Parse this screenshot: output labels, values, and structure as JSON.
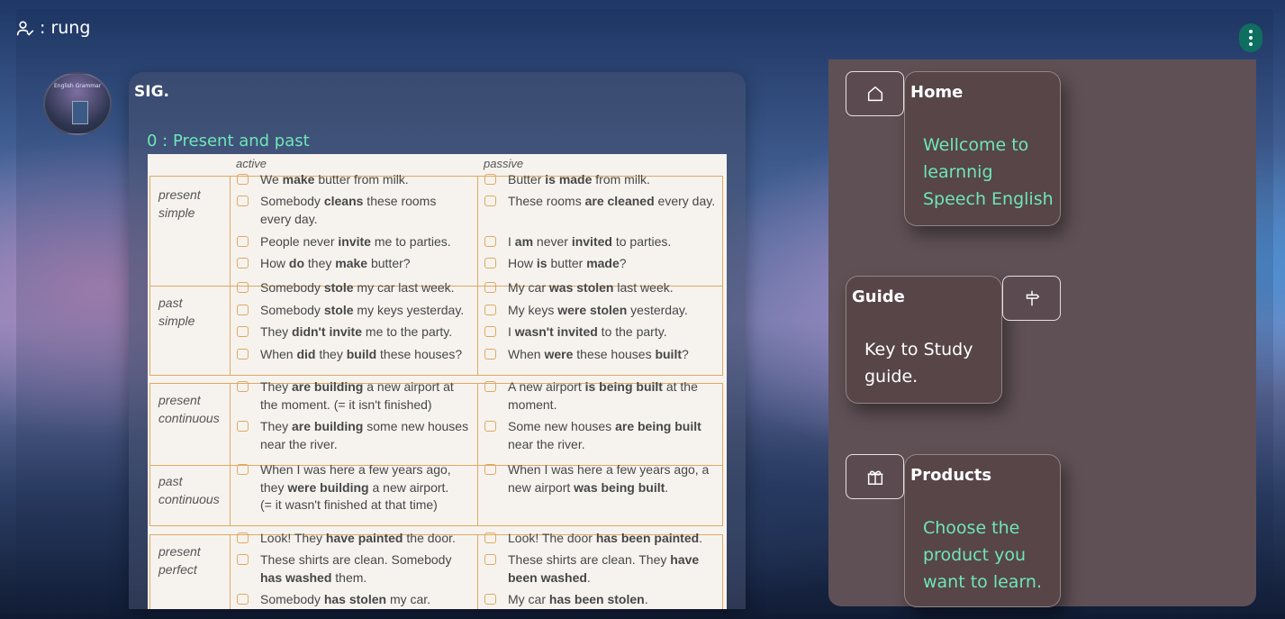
{
  "user": {
    "icon": "user-check-icon",
    "label": ": rung"
  },
  "post": {
    "author": "SIG.",
    "title": "0 : Present and past",
    "grammar_page": {
      "col_active": "active",
      "col_passive": "passive",
      "rows": [
        {
          "tense": [
            "present",
            "simple"
          ]
        },
        {
          "tense": [
            "past",
            "simple"
          ]
        },
        {
          "tense": [
            "present",
            "continuous"
          ]
        },
        {
          "tense": [
            "past",
            "continuous"
          ]
        },
        {
          "tense": [
            "present",
            "perfect"
          ]
        }
      ],
      "active_items": [
        [
          "We ",
          {
            "b": "make"
          },
          " butter from milk."
        ],
        [
          "Somebody ",
          {
            "b": "cleans"
          },
          " these rooms"
        ],
        [
          "every day."
        ],
        [
          "People never ",
          {
            "b": "invite"
          },
          " me to parties."
        ],
        [
          "How ",
          {
            "b": "do"
          },
          " they ",
          {
            "b": "make"
          },
          " butter?"
        ],
        [
          "Somebody ",
          {
            "b": "stole"
          },
          " my car last week."
        ],
        [
          "Somebody ",
          {
            "b": "stole"
          },
          " my keys yesterday."
        ],
        [
          "They ",
          {
            "b": "didn't invite"
          },
          " me to the party."
        ],
        [
          "When ",
          {
            "b": "did"
          },
          " they ",
          {
            "b": "build"
          },
          " these houses?"
        ],
        [
          "They ",
          {
            "b": "are building"
          },
          " a new airport at"
        ],
        [
          "the moment.   (= it isn't finished)"
        ],
        [
          "They ",
          {
            "b": "are building"
          },
          " some new houses"
        ],
        [
          "near the river."
        ],
        [
          "When I was here a few years ago,"
        ],
        [
          "they ",
          {
            "b": "were building"
          },
          " a new airport."
        ],
        [
          "(= it wasn't finished at that time)"
        ],
        [
          "Look!  They ",
          {
            "b": "have painted"
          },
          " the door."
        ],
        [
          "These shirts are clean.  Somebody"
        ],
        [
          {
            "b": "has washed"
          },
          " them."
        ],
        [
          "Somebody ",
          {
            "b": "has stolen"
          },
          " my car."
        ]
      ],
      "passive_items": [
        [
          "Butter ",
          {
            "b": "is made"
          },
          " from milk."
        ],
        [
          "These rooms ",
          {
            "b": "are cleaned"
          },
          " every day."
        ],
        [
          "I ",
          {
            "b": "am"
          },
          " never ",
          {
            "b": "invited"
          },
          " to parties."
        ],
        [
          "How ",
          {
            "b": "is"
          },
          " butter ",
          {
            "b": "made"
          },
          "?"
        ],
        [
          "My car ",
          {
            "b": "was stolen"
          },
          " last week."
        ],
        [
          "My keys ",
          {
            "b": "were stolen"
          },
          " yesterday."
        ],
        [
          "I ",
          {
            "b": "wasn't invited"
          },
          " to the party."
        ],
        [
          "When ",
          {
            "b": "were"
          },
          " these houses ",
          {
            "b": "built"
          },
          "?"
        ],
        [
          "A new airport ",
          {
            "b": "is being built"
          },
          " at the"
        ],
        [
          "moment."
        ],
        [
          "Some new houses ",
          {
            "b": "are being built"
          }
        ],
        [
          "near the river."
        ],
        [
          "When I was here a few years ago, a"
        ],
        [
          "new airport ",
          {
            "b": "was being built"
          },
          "."
        ],
        [
          "Look!  The door ",
          {
            "b": "has been painted"
          },
          "."
        ],
        [
          "These shirts are clean.  They ",
          {
            "b": "have"
          }
        ],
        [
          {
            "b": "been washed"
          },
          "."
        ],
        [
          "My car ",
          {
            "b": "has been stolen"
          },
          "."
        ]
      ]
    }
  },
  "sidebar": {
    "cards": [
      {
        "title": "Home",
        "icon": "home-icon",
        "lines": [
          "Wellcome to",
          "learnnig",
          "Speech English"
        ],
        "color": "#6ee6b8"
      },
      {
        "title": "Guide",
        "icon": "signpost-icon",
        "lines": [
          "Key to Study",
          "guide."
        ],
        "color": "#ffffff"
      },
      {
        "title": "Products",
        "icon": "gift-icon",
        "lines": [
          "Choose the",
          "product you",
          "want to learn."
        ],
        "color": "#6ee6b8"
      }
    ]
  },
  "menu": {
    "icon": "more-vertical-icon"
  }
}
